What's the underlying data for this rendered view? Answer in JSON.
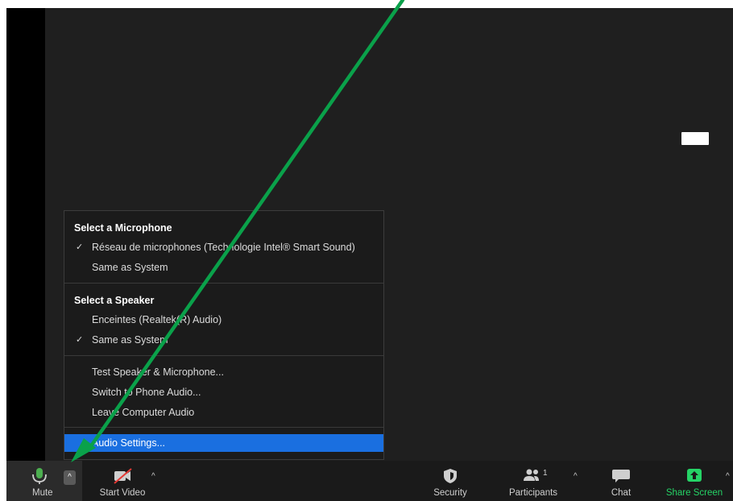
{
  "audio_menu": {
    "mic_header": "Select a Microphone",
    "mic_items": [
      {
        "label": "Réseau de microphones (Technologie Intel® Smart Sound)",
        "checked": true
      },
      {
        "label": "Same as System",
        "checked": false
      }
    ],
    "speaker_header": "Select a Speaker",
    "speaker_items": [
      {
        "label": "Enceintes (Realtek(R) Audio)",
        "checked": false
      },
      {
        "label": "Same as System",
        "checked": true
      }
    ],
    "actions": [
      {
        "label": "Test Speaker & Microphone..."
      },
      {
        "label": "Switch to Phone Audio..."
      },
      {
        "label": "Leave Computer Audio"
      }
    ],
    "settings_label": "Audio Settings...",
    "check_glyph": "✓"
  },
  "toolbar": {
    "mute_label": "Mute",
    "start_video_label": "Start Video",
    "security_label": "Security",
    "participants_label": "Participants",
    "participants_count": "1",
    "chat_label": "Chat",
    "share_screen_label": "Share Screen",
    "caret_glyph": "^"
  },
  "icons": {
    "mute": "microphone-icon",
    "video": "video-off-icon",
    "security": "shield-icon",
    "participants": "people-icon",
    "chat": "chat-bubble-icon",
    "share": "share-screen-icon"
  },
  "colors": {
    "highlight": "#1a6fe0",
    "share_green": "#25d366",
    "mic_green": "#4caf50",
    "annotation_arrow": "#0aa14a",
    "video_off_red": "#e53935"
  }
}
